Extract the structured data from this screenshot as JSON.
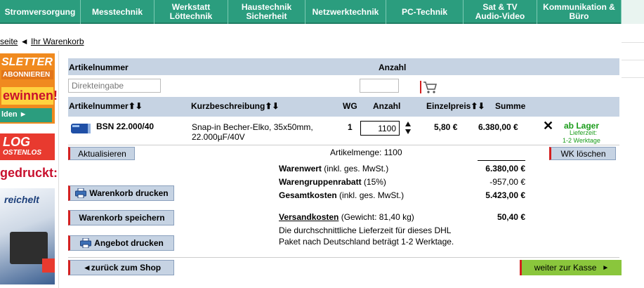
{
  "nav": {
    "items": [
      {
        "label": "Stromversorgung"
      },
      {
        "label": "Messtechnik"
      },
      {
        "label": "Werkstatt\nLöttechnik"
      },
      {
        "label": "Haustechnik\nSicherheit"
      },
      {
        "label": "Netzwerktechnik"
      },
      {
        "label": "PC-Technik"
      },
      {
        "label": "Sat & TV\nAudio-Video"
      },
      {
        "label": "Kommunikation &\nBüro"
      }
    ]
  },
  "breadcrumb": {
    "home": "seite",
    "arrow": "◄",
    "current": "Ihr Warenkorb"
  },
  "sidebar": {
    "promo1": {
      "line1": "SLETTER",
      "line2": "ABONNIEREN",
      "line3": "ewinnen!",
      "line4": "lden ►"
    },
    "promo2": {
      "line1": "LOG",
      "line2": "OSTENLOS",
      "line3": "gedruckt:",
      "logo": "reichelt"
    }
  },
  "quick_add": {
    "col_article": "Artikelnummer",
    "col_qty": "Anzahl",
    "placeholder": "Direkteingabe"
  },
  "table": {
    "headers": {
      "article": "Artikelnummer",
      "sort_glyph": "⬆⬇",
      "description": "Kurzbeschreibung",
      "wg": "WG",
      "qty": "Anzahl",
      "unit_price": "Einzelpreis",
      "sum": "Summe"
    },
    "rows": [
      {
        "article": "BSN 22.000/40",
        "description_line1": "Snap-in Becher-Elko, 35x50mm,",
        "description_line2": "22.000µF/40V",
        "wg": "1",
        "qty": "1100",
        "unit_price": "5,80 €",
        "sum": "6.380,00 €",
        "remove": "✕",
        "stock": "ab Lager",
        "delivery_label": "Lieferzeit:",
        "delivery": "1-2 Werktage"
      }
    ]
  },
  "actions": {
    "update": "Aktualisieren",
    "article_count": "Artikelmenge: 1100",
    "clear_cart": "WK löschen",
    "print_cart": "Warenkorb drucken",
    "save_cart": "Warenkorb speichern",
    "print_offer": "Angebot drucken",
    "back": "◄zurück zum Shop",
    "checkout": "weiter zur Kasse",
    "checkout_arrow": "►"
  },
  "summary": {
    "goods_label": "Warenwert",
    "goods_note": "(inkl. ges. MwSt.)",
    "goods_value": "6.380,00 €",
    "discount_label": "Warengruppenrabatt",
    "discount_note": "(15%)",
    "discount_value": "-957,00 €",
    "total_label": "Gesamtkosten",
    "total_note": "(inkl. ges. MwSt.)",
    "total_value": "5.423,00 €",
    "shipping_label": "Versandkosten",
    "shipping_note": "(Gewicht: 81,40 kg)",
    "shipping_value": "50,40 €",
    "shipping_info_line1": "Die durchschnittliche Lieferzeit für dieses DHL",
    "shipping_info_line2": "Paket nach Deutschland beträgt 1-2 Werktage."
  }
}
